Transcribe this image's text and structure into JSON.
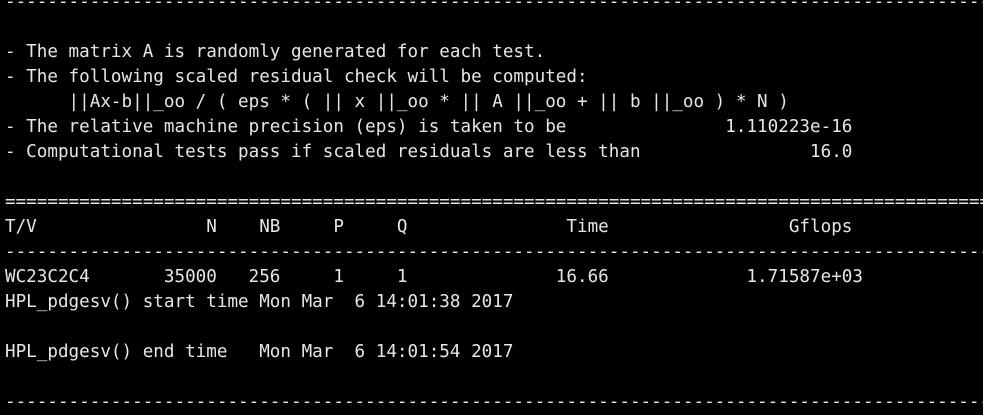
{
  "terminal": {
    "lines": [
      "----------------------------------------------------------------------------------------------",
      "",
      "- The matrix A is randomly generated for each test.",
      "- The following scaled residual check will be computed:",
      "      ||Ax-b||_oo / ( eps * ( || x ||_oo * || A ||_oo + || b ||_oo ) * N )",
      "- The relative machine precision (eps) is taken to be               1.110223e-16",
      "- Computational tests pass if scaled residuals are less than                16.0",
      "",
      "==============================================================================================",
      "T/V                N    NB     P     Q               Time                 Gflops",
      "----------------------------------------------------------------------------------------------",
      "WC23C2C4       35000   256     1     1              16.66             1.71587e+03",
      "HPL_pdgesv() start time Mon Mar  6 14:01:38 2017",
      "",
      "HPL_pdgesv() end time   Mon Mar  6 14:01:54 2017",
      "",
      "----------------------------------------------------------------------------------------------"
    ]
  }
}
